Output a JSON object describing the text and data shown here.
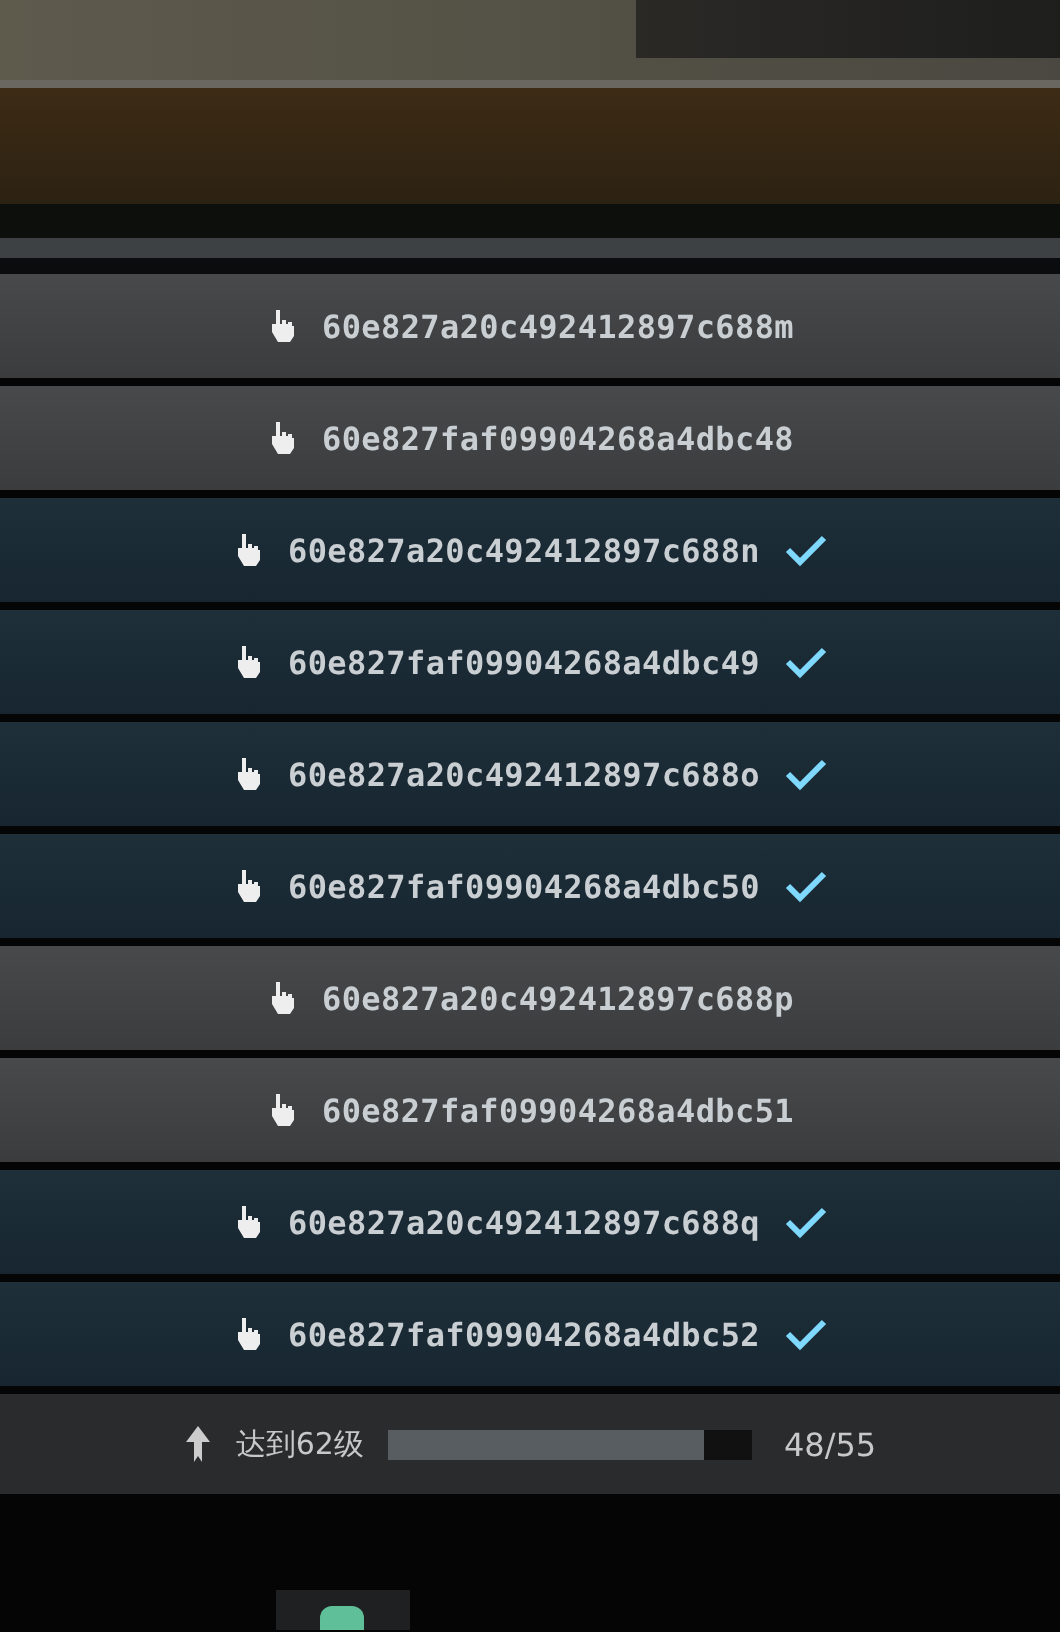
{
  "codes": [
    {
      "code": "60e827a20c492412897c688m",
      "checked": false
    },
    {
      "code": "60e827faf09904268a4dbc48",
      "checked": false
    },
    {
      "code": "60e827a20c492412897c688n",
      "checked": true
    },
    {
      "code": "60e827faf09904268a4dbc49",
      "checked": true
    },
    {
      "code": "60e827a20c492412897c688o",
      "checked": true
    },
    {
      "code": "60e827faf09904268a4dbc50",
      "checked": true
    },
    {
      "code": "60e827a20c492412897c688p",
      "checked": false
    },
    {
      "code": "60e827faf09904268a4dbc51",
      "checked": false
    },
    {
      "code": "60e827a20c492412897c688q",
      "checked": true
    },
    {
      "code": "60e827faf09904268a4dbc52",
      "checked": true
    }
  ],
  "progress": {
    "label": "达到62级",
    "level": 0.87,
    "reading": "48/55"
  }
}
